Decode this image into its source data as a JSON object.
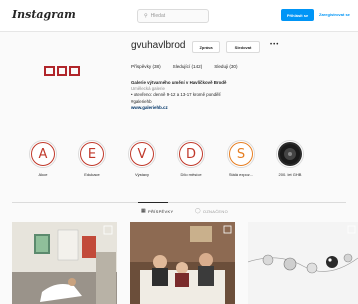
{
  "header": {
    "logo": "Instagram",
    "search_placeholder": "Hledat",
    "login_label": "Přihlásit se",
    "signup_label": "Zaregistrovat se"
  },
  "profile": {
    "username": "gvuhavlbrod",
    "message_label": "Zpráva",
    "follow_label": "Sledovat",
    "more_label": "•••",
    "posts": "Příspěvky (38)",
    "followers": "Sledující (142)",
    "following": "Sleduji (30)",
    "bio": {
      "name": "Galerie výtvarného umění v Havlíčkově Brodě",
      "category": "Umělecká galerie",
      "line1": "• otevřeno: denně 9-12 a 13-17 kromě pondělí",
      "hashtag": "#galeriehb",
      "website": "www.galeriehb.cz"
    }
  },
  "highlights": [
    {
      "letter": "A",
      "label": "Akce",
      "color": "#c0392b"
    },
    {
      "letter": "E",
      "label": "Edukace",
      "color": "#c0392b"
    },
    {
      "letter": "V",
      "label": "Výstavy",
      "color": "#c0392b"
    },
    {
      "letter": "D",
      "label": "Dílo měsíce",
      "color": "#c0392b"
    },
    {
      "letter": "S",
      "label": "Stálá expoz...",
      "color": "#e67e22"
    },
    {
      "letter": "",
      "label": "200. let GHB",
      "color": "#333333"
    }
  ],
  "tabs": {
    "posts_label": "PŘÍSPĚVKY",
    "tagged_label": "OZNAČENO"
  },
  "icons": {
    "search": "search-icon",
    "grid": "grid-icon",
    "tag": "tag-icon"
  }
}
